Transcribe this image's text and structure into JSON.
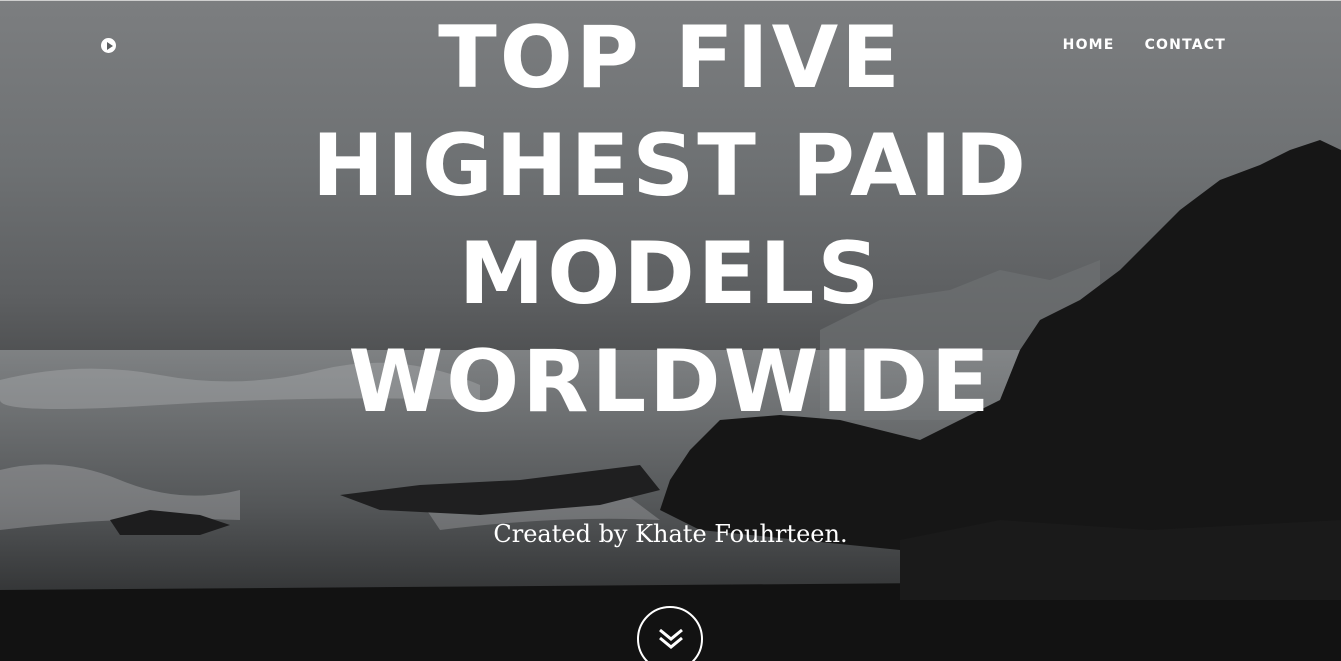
{
  "logo": {
    "icon": "play-circle-icon"
  },
  "nav": {
    "items": [
      {
        "label": "HOME"
      },
      {
        "label": "CONTACT"
      }
    ]
  },
  "hero": {
    "title_lines": [
      "TOP FIVE",
      "HIGHEST PAID",
      "MODELS",
      "WORLDWIDE"
    ],
    "subtitle": "Created by Khate Fouhrteen.",
    "scroll_icon": "double-chevron-down-icon"
  },
  "colors": {
    "text": "#ffffff",
    "background": "#5d5f61"
  }
}
